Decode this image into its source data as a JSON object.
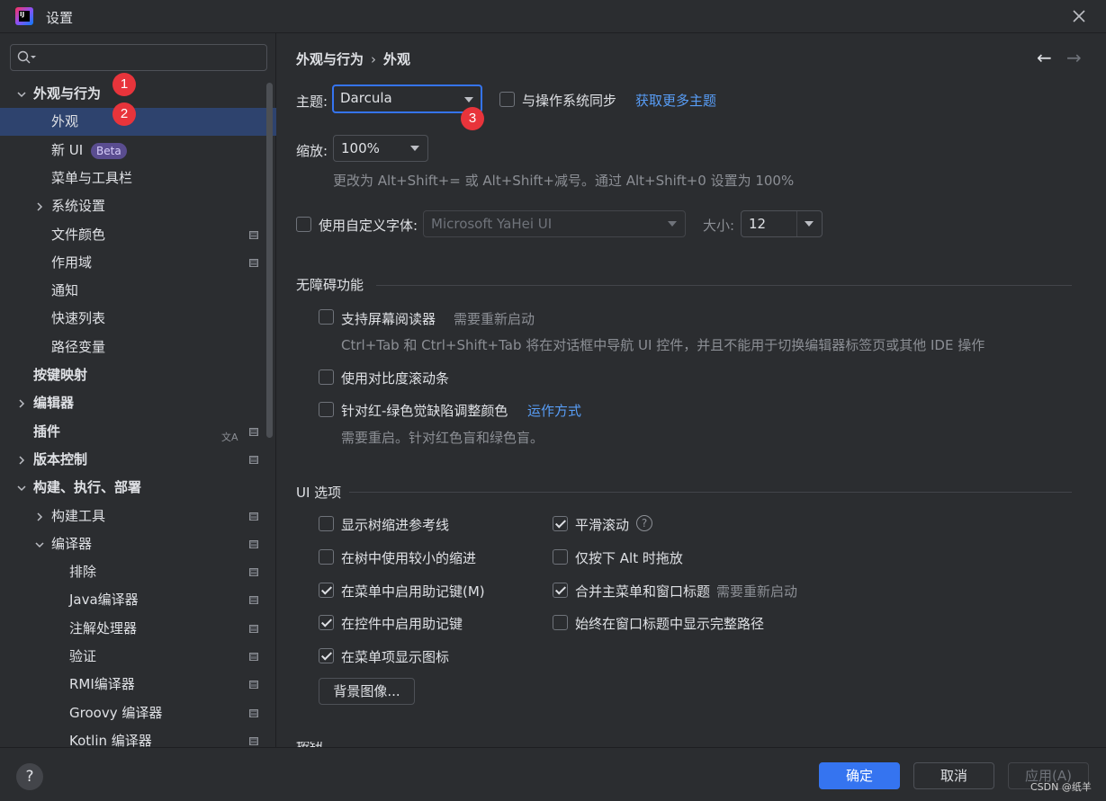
{
  "window": {
    "title": "设置"
  },
  "sidebar": {
    "search": {
      "value": "",
      "placeholder": ""
    },
    "items": [
      {
        "label": "外观与行为",
        "level": 0,
        "expandable": true,
        "expanded": true,
        "bold": true
      },
      {
        "label": "外观",
        "level": 1,
        "selected": true
      },
      {
        "label": "新 UI",
        "level": 1,
        "badge": "Beta"
      },
      {
        "label": "菜单与工具栏",
        "level": 1
      },
      {
        "label": "系统设置",
        "level": 1,
        "expandable": true,
        "expanded": false
      },
      {
        "label": "文件颜色",
        "level": 1,
        "tag": true
      },
      {
        "label": "作用域",
        "level": 1,
        "tag": true
      },
      {
        "label": "通知",
        "level": 1
      },
      {
        "label": "快速列表",
        "level": 1
      },
      {
        "label": "路径变量",
        "level": 1
      },
      {
        "label": "按键映射",
        "level": 0,
        "bold": true
      },
      {
        "label": "编辑器",
        "level": 0,
        "expandable": true,
        "expanded": false,
        "bold": true
      },
      {
        "label": "插件",
        "level": 0,
        "bold": true,
        "tag": true,
        "translate_icon": true
      },
      {
        "label": "版本控制",
        "level": 0,
        "expandable": true,
        "expanded": false,
        "bold": true,
        "tag": true
      },
      {
        "label": "构建、执行、部署",
        "level": 0,
        "expandable": true,
        "expanded": true,
        "bold": true
      },
      {
        "label": "构建工具",
        "level": 1,
        "expandable": true,
        "expanded": false,
        "tag": true
      },
      {
        "label": "编译器",
        "level": 1,
        "expandable": true,
        "expanded": true,
        "tag": true
      },
      {
        "label": "排除",
        "level": 2,
        "tag": true
      },
      {
        "label": "Java编译器",
        "level": 2,
        "tag": true
      },
      {
        "label": "注解处理器",
        "level": 2,
        "tag": true
      },
      {
        "label": "验证",
        "level": 2,
        "tag": true
      },
      {
        "label": "RMI编译器",
        "level": 2,
        "tag": true
      },
      {
        "label": "Groovy 编译器",
        "level": 2,
        "tag": true
      },
      {
        "label": "Kotlin 编译器",
        "level": 2,
        "tag": true
      }
    ]
  },
  "annotations": [
    "1",
    "2",
    "3"
  ],
  "main": {
    "breadcrumb": {
      "parent": "外观与行为",
      "separator": "›",
      "current": "外观"
    },
    "theme": {
      "label": "主题:",
      "value": "Darcula",
      "sync_label": "与操作系统同步",
      "sync_checked": false,
      "more_link": "获取更多主题"
    },
    "zoom": {
      "label": "缩放:",
      "value": "100%",
      "hint": "更改为 Alt+Shift+= 或 Alt+Shift+减号。通过 Alt+Shift+0 设置为 100%"
    },
    "font": {
      "checkbox_label": "使用自定义字体:",
      "checked": false,
      "value": "Microsoft YaHei UI",
      "size_label": "大小:",
      "size_value": "12"
    },
    "accessibility": {
      "title": "无障碍功能",
      "screen_reader": {
        "label": "支持屏幕阅读器",
        "checked": false,
        "note": "需要重新启动",
        "hint": "Ctrl+Tab 和 Ctrl+Shift+Tab 将在对话框中导航 UI 控件，并且不能用于切换编辑器标签页或其他 IDE 操作"
      },
      "contrast_scrollbar": {
        "label": "使用对比度滚动条",
        "checked": false
      },
      "color_deficiency": {
        "label": "针对红-绿色觉缺陷调整颜色",
        "checked": false,
        "link": "运作方式",
        "hint": "需要重启。针对红色盲和绿色盲。"
      }
    },
    "ui_options": {
      "title": "UI 选项",
      "left": [
        {
          "label": "显示树缩进参考线",
          "checked": false
        },
        {
          "label": "在树中使用较小的缩进",
          "checked": false
        },
        {
          "label": "在菜单中启用助记键(M)",
          "checked": true
        },
        {
          "label": "在控件中启用助记键",
          "checked": true
        },
        {
          "label": "在菜单项显示图标",
          "checked": true
        }
      ],
      "right": [
        {
          "label": "平滑滚动",
          "checked": true,
          "help": "?"
        },
        {
          "label": "仅按下 Alt 时拖放",
          "checked": false
        },
        {
          "label": "合并主菜单和窗口标题",
          "checked": true,
          "note": "需要重新启动"
        },
        {
          "label": "始终在窗口标题中显示完整路径",
          "checked": false
        }
      ],
      "background_button": "背景图像..."
    },
    "next_section_partial": "按钮"
  },
  "footer": {
    "help": "?",
    "ok": "确定",
    "cancel": "取消",
    "apply": "应用(A)"
  },
  "watermark": "CSDN @纸羊",
  "colors": {
    "accent": "#3574f0",
    "selection": "#2e436e",
    "link": "#589df6",
    "badge": "#e8343b",
    "background": "#2b2d30"
  }
}
